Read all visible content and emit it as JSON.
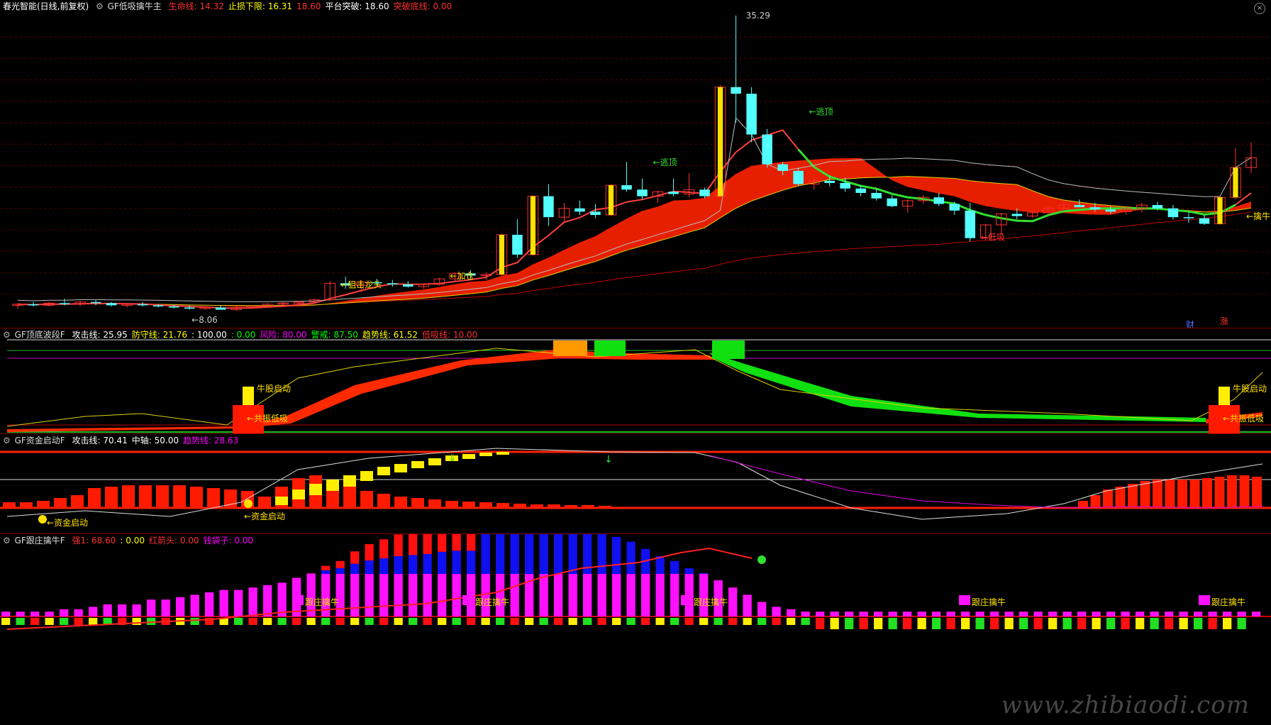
{
  "panel1": {
    "title": "春光智能(日线,前复权)",
    "indicator": "GF低吸擒牛主",
    "items": [
      {
        "label": "生命线:",
        "value": "14.32",
        "color": "#ff3030"
      },
      {
        "label": "止损下限:",
        "value": "16.31",
        "color": "#ffff00"
      },
      {
        "label": "",
        "value": "18.60",
        "color": "#ff3030"
      },
      {
        "label": "平台突破:",
        "value": "18.60",
        "color": "#ffffff"
      },
      {
        "label": "突破底线:",
        "value": "0.00",
        "color": "#ff3030"
      }
    ],
    "high_label": "35.29",
    "low_label": "8.06",
    "annotations": [
      "逃顶",
      "逃顶",
      "加仓",
      "狙击龙头",
      "低吸",
      "擒牛"
    ],
    "markers": [
      "财",
      "涨"
    ]
  },
  "panel2": {
    "indicator": "GF顶底波段F",
    "items": [
      {
        "label": "攻击线:",
        "value": "25.95",
        "color": "#ffffff"
      },
      {
        "label": "防守线:",
        "value": "21.76",
        "color": "#ffff00"
      },
      {
        "label": "",
        "value": ": 100.00",
        "color": "#ffffff"
      },
      {
        "label": "",
        "value": ": 0.00",
        "color": "#00ff00"
      },
      {
        "label": "风险:",
        "value": "80.00",
        "color": "#ff00ff"
      },
      {
        "label": "警戒:",
        "value": "87.50",
        "color": "#00ff00"
      },
      {
        "label": "趋势线:",
        "value": "61.52",
        "color": "#ffff00"
      },
      {
        "label": "低吸线:",
        "value": "10.00",
        "color": "#ff3030"
      }
    ],
    "annotations": [
      "牛股启动",
      "共振低吸",
      "牛股启动",
      "共振低吸"
    ]
  },
  "panel3": {
    "indicator": "GF资金启动F",
    "items": [
      {
        "label": "攻击线:",
        "value": "70.41",
        "color": "#ffffff"
      },
      {
        "label": "中轴:",
        "value": "50.00",
        "color": "#ffffff"
      },
      {
        "label": "趋势线:",
        "value": "28.63",
        "color": "#ff00ff"
      }
    ],
    "annotations": [
      "资金启动",
      "资金启动"
    ]
  },
  "panel4": {
    "indicator": "GF跟庄擒牛F",
    "items": [
      {
        "label": "强1:",
        "value": "68.60",
        "color": "#ff3030"
      },
      {
        "label": "",
        "value": ": 0.00",
        "color": "#ffff00"
      },
      {
        "label": "红箭头:",
        "value": "0.00",
        "color": "#ff3030"
      },
      {
        "label": "钱袋子:",
        "value": "0.00",
        "color": "#ff00ff"
      }
    ],
    "annotations": [
      "跟庄擒牛",
      "跟庄擒牛",
      "跟庄擒牛",
      "跟庄擒牛",
      "跟庄擒牛"
    ]
  },
  "watermark": "www.zhibiaodi.com",
  "chart_data": {
    "type": "candlestick",
    "title": "春光智能(日线,前复权)",
    "price_range": [
      8.06,
      35.29
    ],
    "candles": [
      [
        9.0,
        9.2,
        8.7,
        9.1
      ],
      [
        9.1,
        9.3,
        8.9,
        9.0
      ],
      [
        9.0,
        9.3,
        8.9,
        9.2
      ],
      [
        9.2,
        9.6,
        9.0,
        9.1
      ],
      [
        9.1,
        9.4,
        8.9,
        9.3
      ],
      [
        9.3,
        9.5,
        9.0,
        9.2
      ],
      [
        9.2,
        9.3,
        8.9,
        9.0
      ],
      [
        9.0,
        9.2,
        8.8,
        9.1
      ],
      [
        9.1,
        9.3,
        8.9,
        9.0
      ],
      [
        9.0,
        9.1,
        8.8,
        8.9
      ],
      [
        8.9,
        9.1,
        8.7,
        8.8
      ],
      [
        8.8,
        9.0,
        8.6,
        8.7
      ],
      [
        8.7,
        8.9,
        8.6,
        8.8
      ],
      [
        8.8,
        9.0,
        8.6,
        8.6
      ],
      [
        8.6,
        8.9,
        8.5,
        8.8
      ],
      [
        8.8,
        9.0,
        8.7,
        8.9
      ],
      [
        8.9,
        9.2,
        8.8,
        9.1
      ],
      [
        9.1,
        9.3,
        9.0,
        9.2
      ],
      [
        9.2,
        9.4,
        9.0,
        9.3
      ],
      [
        9.3,
        9.6,
        9.2,
        9.5
      ],
      [
        9.5,
        11.2,
        9.4,
        11.0
      ],
      [
        11.0,
        11.6,
        10.5,
        10.8
      ],
      [
        10.8,
        11.3,
        10.2,
        11.1
      ],
      [
        11.1,
        11.4,
        10.8,
        11.0
      ],
      [
        11.0,
        11.3,
        10.7,
        10.9
      ],
      [
        10.9,
        11.2,
        10.6,
        10.7
      ],
      [
        10.7,
        11.0,
        10.5,
        10.9
      ],
      [
        10.9,
        11.5,
        10.8,
        11.4
      ],
      [
        11.4,
        12.0,
        11.1,
        11.9
      ],
      [
        11.9,
        12.2,
        11.4,
        11.7
      ],
      [
        11.7,
        12.0,
        11.3,
        11.8
      ],
      [
        11.8,
        15.5,
        11.7,
        15.4
      ],
      [
        15.4,
        16.8,
        13.3,
        13.6
      ],
      [
        13.6,
        19.0,
        13.5,
        18.9
      ],
      [
        18.9,
        20.0,
        16.2,
        17.0
      ],
      [
        17.0,
        18.3,
        16.5,
        17.8
      ],
      [
        17.8,
        18.5,
        17.2,
        17.5
      ],
      [
        17.5,
        18.2,
        16.9,
        17.2
      ],
      [
        17.2,
        20.0,
        17.1,
        19.9
      ],
      [
        19.9,
        22.0,
        19.3,
        19.5
      ],
      [
        19.5,
        20.5,
        18.6,
        18.9
      ],
      [
        18.9,
        19.4,
        18.3,
        19.3
      ],
      [
        19.3,
        20.5,
        18.9,
        19.1
      ],
      [
        19.1,
        21.0,
        18.8,
        19.5
      ],
      [
        19.5,
        19.7,
        18.7,
        18.9
      ],
      [
        18.9,
        29.0,
        18.8,
        28.8
      ],
      [
        28.8,
        35.29,
        25.6,
        28.2
      ],
      [
        28.2,
        28.8,
        23.8,
        24.5
      ],
      [
        24.5,
        25.0,
        21.5,
        21.8
      ],
      [
        21.8,
        22.0,
        20.8,
        21.2
      ],
      [
        21.2,
        21.5,
        19.8,
        20.0
      ],
      [
        20.0,
        20.6,
        19.5,
        20.3
      ],
      [
        20.3,
        20.8,
        19.8,
        20.1
      ],
      [
        20.1,
        20.6,
        19.3,
        19.6
      ],
      [
        19.6,
        19.9,
        18.9,
        19.2
      ],
      [
        19.2,
        19.6,
        18.5,
        18.7
      ],
      [
        18.7,
        19.0,
        17.9,
        18.0
      ],
      [
        18.0,
        18.6,
        17.4,
        18.5
      ],
      [
        18.5,
        19.0,
        18.2,
        18.8
      ],
      [
        18.8,
        19.2,
        18.0,
        18.2
      ],
      [
        18.2,
        18.4,
        17.2,
        17.6
      ],
      [
        17.6,
        18.3,
        14.8,
        15.1
      ],
      [
        15.1,
        16.4,
        14.9,
        16.3
      ],
      [
        16.3,
        17.4,
        15.4,
        17.3
      ],
      [
        17.3,
        17.8,
        16.8,
        17.1
      ],
      [
        17.1,
        17.6,
        16.9,
        17.4
      ],
      [
        17.4,
        18.0,
        17.2,
        17.8
      ],
      [
        17.8,
        18.4,
        17.5,
        18.1
      ],
      [
        18.1,
        18.6,
        17.9,
        17.9
      ],
      [
        17.9,
        18.3,
        17.5,
        17.7
      ],
      [
        17.7,
        18.0,
        17.3,
        17.5
      ],
      [
        17.5,
        18.0,
        17.2,
        17.8
      ],
      [
        17.8,
        18.3,
        17.4,
        18.1
      ],
      [
        18.1,
        18.4,
        17.6,
        17.8
      ],
      [
        17.8,
        18.1,
        16.8,
        17.0
      ],
      [
        17.0,
        17.5,
        16.5,
        16.9
      ],
      [
        16.9,
        17.2,
        16.3,
        16.4
      ],
      [
        16.4,
        18.9,
        16.3,
        18.8
      ],
      [
        18.8,
        23.3,
        18.6,
        21.5
      ],
      [
        21.5,
        23.8,
        21.0,
        22.4
      ]
    ]
  }
}
